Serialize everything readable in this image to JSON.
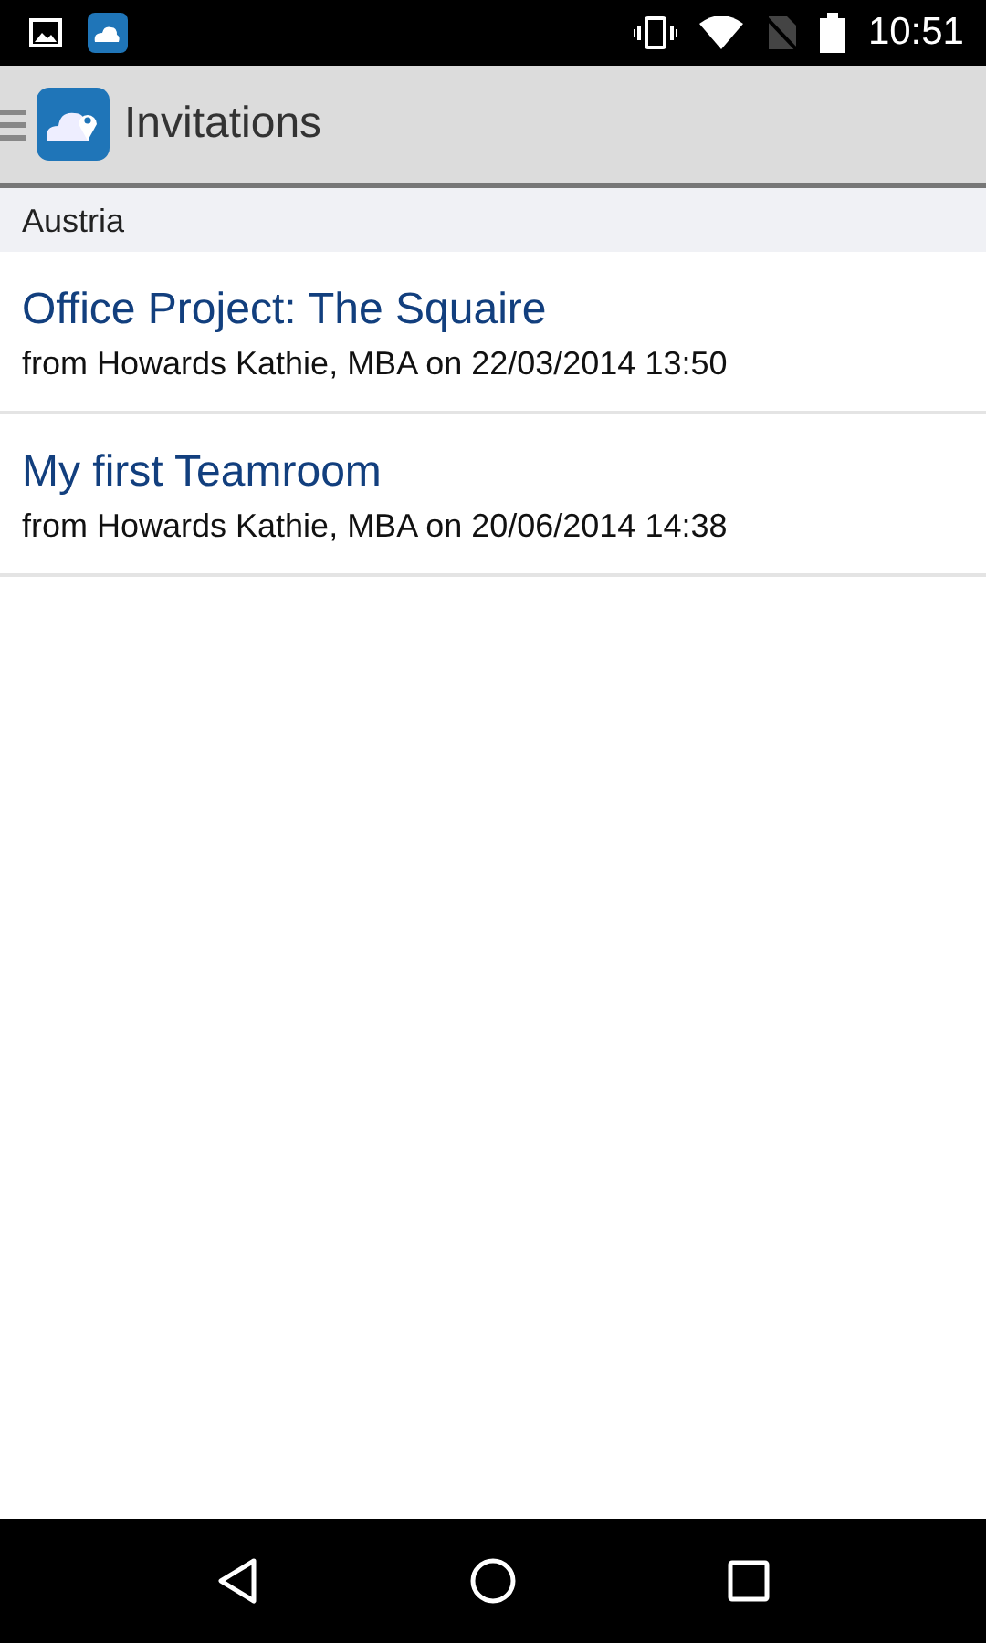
{
  "status_bar": {
    "time": "10:51"
  },
  "app_bar": {
    "title": "Invitations"
  },
  "sections": [
    {
      "header": "Austria",
      "items": [
        {
          "title": "Office Project: The Squaire",
          "subtitle": "from Howards Kathie, MBA on 22/03/2014 13:50"
        },
        {
          "title": "My first Teamroom",
          "subtitle": "from Howards Kathie, MBA on 20/06/2014 14:38"
        }
      ]
    }
  ]
}
